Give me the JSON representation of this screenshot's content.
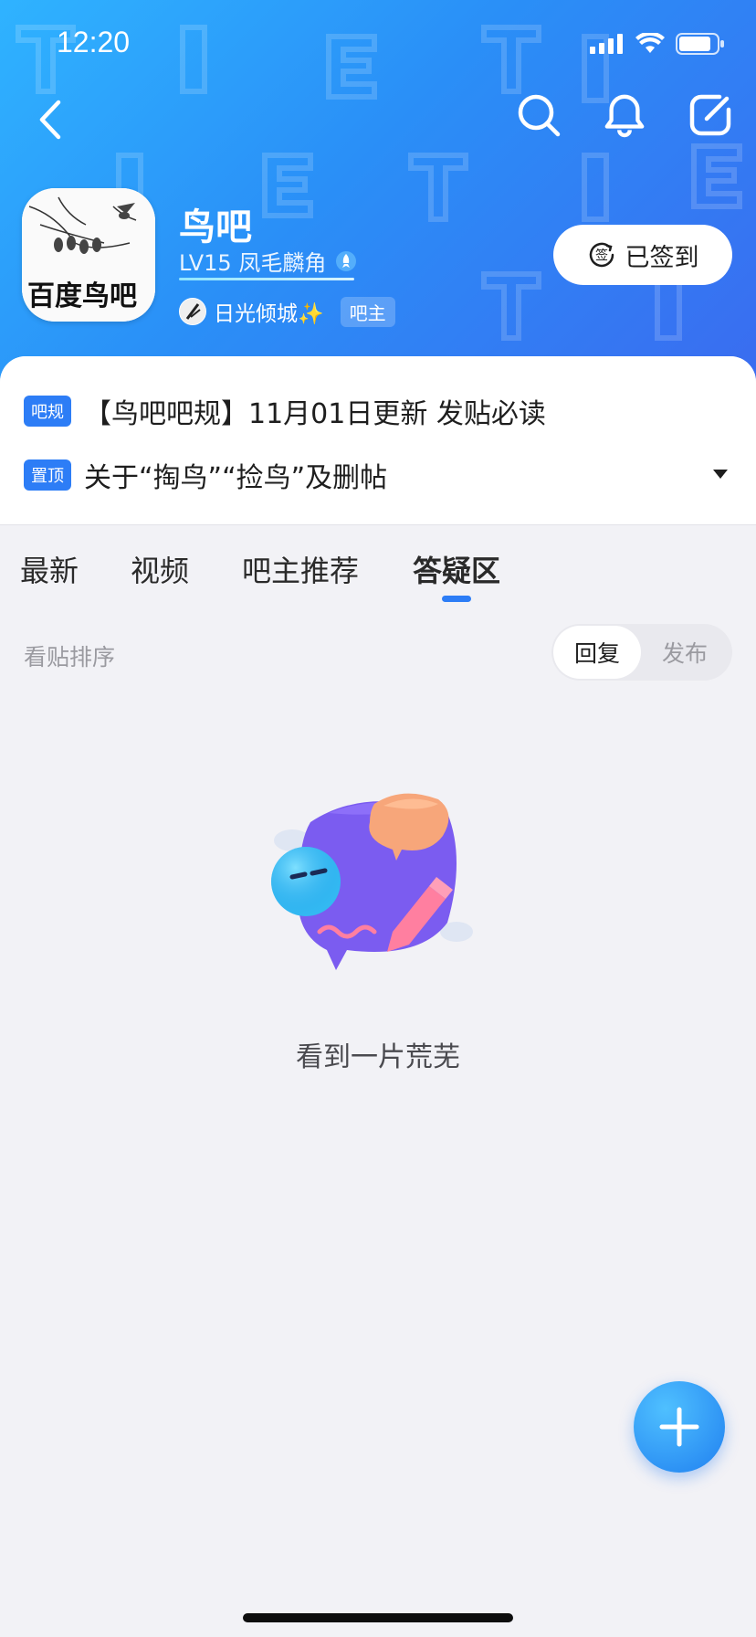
{
  "status_bar": {
    "time": "12:20"
  },
  "bar": {
    "name": "鸟吧",
    "level": "LV15 凤毛麟角",
    "owner_name": "日光倾城✨",
    "owner_badge": "吧主",
    "signin_label": "已签到",
    "signin_icon_glyph": "签"
  },
  "avatar": {
    "calligraphy": "百度鸟吧"
  },
  "notices": [
    {
      "tag": "吧规",
      "text": "【鸟吧吧规】11月01日更新 发贴必读"
    },
    {
      "tag": "置顶",
      "text": "关于“掏鸟”“捡鸟”及删帖"
    }
  ],
  "tabs": [
    {
      "label": "最新"
    },
    {
      "label": "视频"
    },
    {
      "label": "吧主推荐"
    },
    {
      "label": "答疑区",
      "active": true
    }
  ],
  "sort": {
    "label": "看贴排序",
    "options": [
      {
        "label": "回复",
        "selected": true
      },
      {
        "label": "发布"
      }
    ]
  },
  "empty_state": {
    "text": "看到一片荒芜"
  },
  "colors": {
    "header_start": "#2fb3ff",
    "header_end": "#3a6cf0",
    "accent": "#2d7df6",
    "background": "#f2f2f6"
  },
  "icons": {
    "back": "chevron-left-icon",
    "search": "search-icon",
    "bell": "bell-icon",
    "compose": "compose-icon",
    "fab": "plus-icon"
  }
}
